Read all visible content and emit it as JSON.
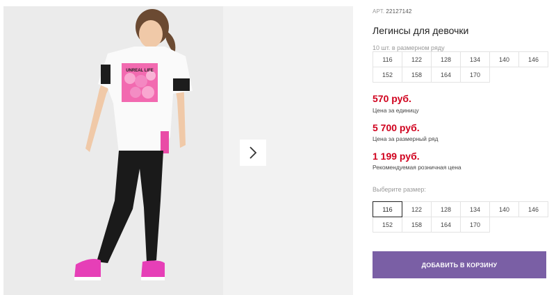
{
  "product": {
    "art_label": "АРТ.",
    "art_number": "22127142",
    "title": "Легинсы для девочки",
    "size_row_label": "10 шт. в размерном ряду",
    "size_row": [
      "116",
      "122",
      "128",
      "134",
      "140",
      "146",
      "152",
      "158",
      "164",
      "170"
    ],
    "prices": [
      {
        "value": "570 руб.",
        "caption": "Цена за единицу"
      },
      {
        "value": "5 700 руб.",
        "caption": "Цена за размерный ряд"
      },
      {
        "value": "1 199 руб.",
        "caption": "Рекомендуемая розничная цена"
      }
    ],
    "choose_size_label": "Выберите размер:",
    "sizes": [
      "116",
      "122",
      "128",
      "134",
      "140",
      "146",
      "152",
      "158",
      "164",
      "170"
    ],
    "selected_size": "116",
    "add_to_cart_label": "ДОБАВИТЬ В КОРЗИНУ",
    "tshirt_print_text": "UNREAL LIFE"
  },
  "colors": {
    "price": "#d0001d",
    "button": "#7a5fa5",
    "sneakers": "#e63fb7",
    "print": "#f26ab0"
  },
  "icons": {
    "next": "chevron-right-icon"
  }
}
